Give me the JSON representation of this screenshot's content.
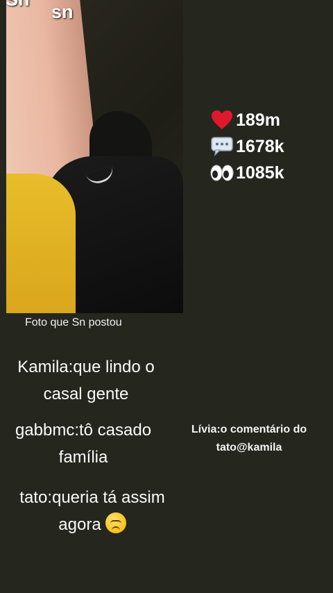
{
  "photo": {
    "overlay_top": "sn",
    "overlay_cut": "Sn"
  },
  "stats": {
    "likes": "189m",
    "comments": "1678k",
    "views": "1085k",
    "icons": [
      "heart-icon",
      "speech-bubble-icon",
      "eyes-icon"
    ]
  },
  "caption": "Foto que Sn postou",
  "comments": [
    {
      "text": "Kamila:que lindo o casal gente"
    },
    {
      "text": "gabbmc:tô casado família"
    },
    {
      "text": "tato:queria tá assim agora"
    }
  ],
  "reply": "Lívia:o comentário do tato@kamila",
  "colors": {
    "background": "#25271f",
    "heart": "#e0182d",
    "text": "#ffffff"
  }
}
